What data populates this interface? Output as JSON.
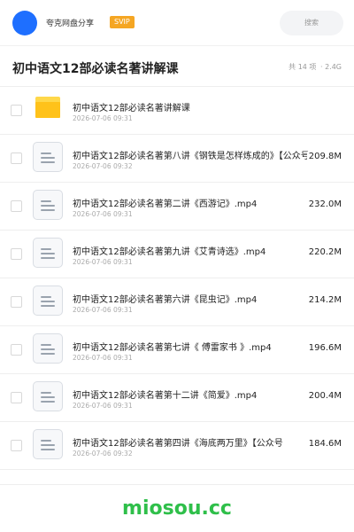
{
  "header": {
    "brand": "夸克网盘分享",
    "badge": "SVIP",
    "search_placeholder": "搜索",
    "accent_color": "#1e6fff",
    "badge_color": "#f5a623"
  },
  "share": {
    "title": "初中语文12部必读名著讲解课",
    "count": "共 14 项",
    "total_size": "· 2.4G"
  },
  "files": [
    {
      "type": "folder",
      "icon": "folder-icon",
      "name": "初中语文12部必读名著讲解课",
      "date": "2026-07-06 09:31",
      "size": ""
    },
    {
      "type": "file",
      "icon": "file-icon",
      "name": "初中语文12部必读名著第八讲《钢铁是怎样炼成的》【公众号",
      "date": "2026-07-06 09:32",
      "size": "209.8M"
    },
    {
      "type": "file",
      "icon": "file-icon",
      "name": "初中语文12部必读名著第二讲《西游记》.mp4",
      "date": "2026-07-06 09:31",
      "size": "232.0M"
    },
    {
      "type": "file",
      "icon": "file-icon",
      "name": "初中语文12部必读名著第九讲《艾青诗选》.mp4",
      "date": "2026-07-06 09:31",
      "size": "220.2M"
    },
    {
      "type": "file",
      "icon": "file-icon",
      "name": "初中语文12部必读名著第六讲《昆虫记》.mp4",
      "date": "2026-07-06 09:31",
      "size": "214.2M"
    },
    {
      "type": "file",
      "icon": "file-icon",
      "name": "初中语文12部必读名著第七讲《 傅雷家书 》.mp4",
      "date": "2026-07-06 09:31",
      "size": "196.6M"
    },
    {
      "type": "file",
      "icon": "file-icon",
      "name": "初中语文12部必读名著第十二讲《简爱》.mp4",
      "date": "2026-07-06 09:31",
      "size": "200.4M"
    },
    {
      "type": "file",
      "icon": "file-icon",
      "name": "初中语文12部必读名著第四讲《海底两万里》【公众号",
      "date": "2026-07-06 09:32",
      "size": "184.6M"
    }
  ],
  "footer": {
    "watermark": "miosou.cc",
    "watermark_color": "#2fbf4a"
  }
}
